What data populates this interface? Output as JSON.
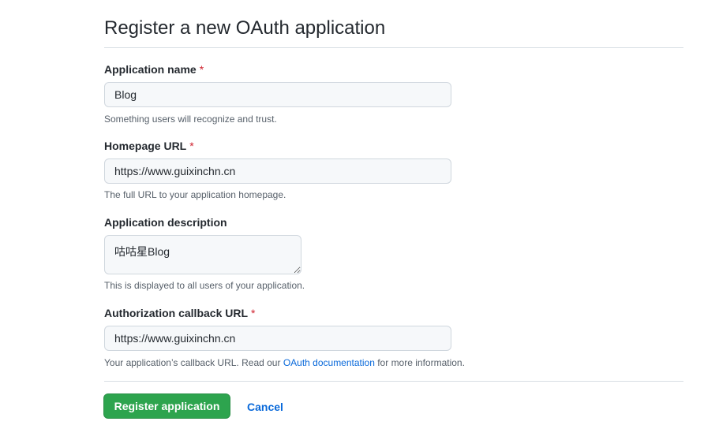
{
  "page": {
    "title": "Register a new OAuth application"
  },
  "form": {
    "app_name": {
      "label": "Application name",
      "required_mark": "*",
      "value": "Blog",
      "note": "Something users will recognize and trust."
    },
    "homepage_url": {
      "label": "Homepage URL",
      "required_mark": "*",
      "value": "https://www.guixinchn.cn",
      "note": "The full URL to your application homepage."
    },
    "description": {
      "label": "Application description",
      "value": "咕咕星Blog",
      "note": "This is displayed to all users of your application."
    },
    "callback_url": {
      "label": "Authorization callback URL",
      "required_mark": "*",
      "value": "https://www.guixinchn.cn",
      "note_prefix": "Your application’s callback URL. Read our ",
      "note_link": "OAuth documentation",
      "note_suffix": " for more information."
    }
  },
  "actions": {
    "register_label": "Register application",
    "cancel_label": "Cancel"
  },
  "colors": {
    "primary_button": "#2da44e",
    "link": "#0969da",
    "required": "#cf222e"
  }
}
